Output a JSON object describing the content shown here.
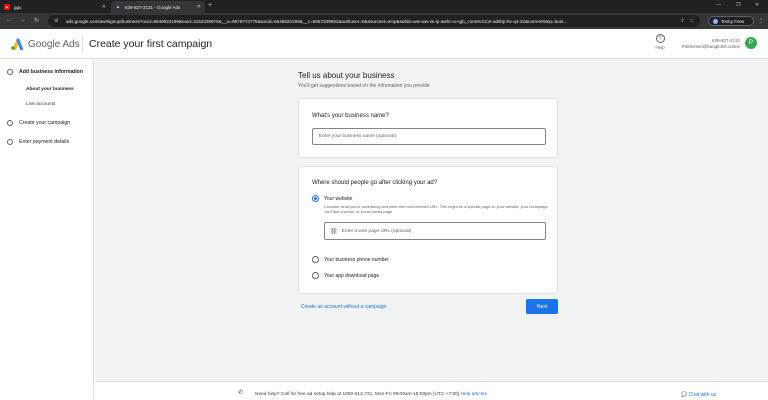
{
  "browser": {
    "tabs": [
      {
        "title": "ggu",
        "active": false
      },
      {
        "title": "639-827-2131 - Google Ads",
        "active": true
      }
    ],
    "url": "ads.google.com/aw/signup/business?ocid=6546924199&euid=1153228975&__u=9878774775&uscid=6546924199&__c=6057339991&authuser=0&sourceid=emp&subid=ww-ww-xs-ip-awhc-a-ogb_cons%21o2-adshp-hv-q4-22&currentStep=busi...",
    "profile_label": "Tenby Fees",
    "accent": "#8ab4f8"
  },
  "header": {
    "brand": "Google Ads",
    "page_title": "Create your first campaign",
    "help_label": "Help",
    "account_id": "639-827-2131",
    "account_email": "Polifeeses@bangkok8.online",
    "avatar_letter": "P"
  },
  "sidebar": {
    "steps": [
      {
        "label": "Add business information",
        "current": true
      },
      {
        "label": "Create your campaign",
        "current": false
      },
      {
        "label": "Enter payment details",
        "current": false
      }
    ],
    "substeps": [
      {
        "label": "About your business",
        "current": true
      },
      {
        "label": "Link accounts",
        "current": false
      }
    ]
  },
  "main": {
    "heading": "Tell us about your business",
    "subheading": "You'll get suggestions based on the information you provide",
    "business_card": {
      "title": "What's your business name?",
      "placeholder": "Enter your business name (optional)"
    },
    "destination_card": {
      "title": "Where should people go after clicking your ad?",
      "options": [
        {
          "label": "Your website",
          "selected": true
        },
        {
          "label": "Your business phone number",
          "selected": false
        },
        {
          "label": "Your app download page",
          "selected": false
        }
      ],
      "website_desc": "Consider what you're advertising and enter the most relevant URL. This might be a specific page on your website, your homepage, YouTube channel, or social media page",
      "url_placeholder": "Enter a web page URL (optional)"
    },
    "skip_link": "Create an account without a campaign",
    "next_label": "Next",
    "primary_color": "#1a73e8"
  },
  "footer": {
    "help_text": "Need help? Call for free ad setup help at 1800-012-731, Mon-Fri 09:00am-18:00pm [UTC +7:00]",
    "help_link": "Help articles",
    "chat_label": "Chat with us"
  }
}
